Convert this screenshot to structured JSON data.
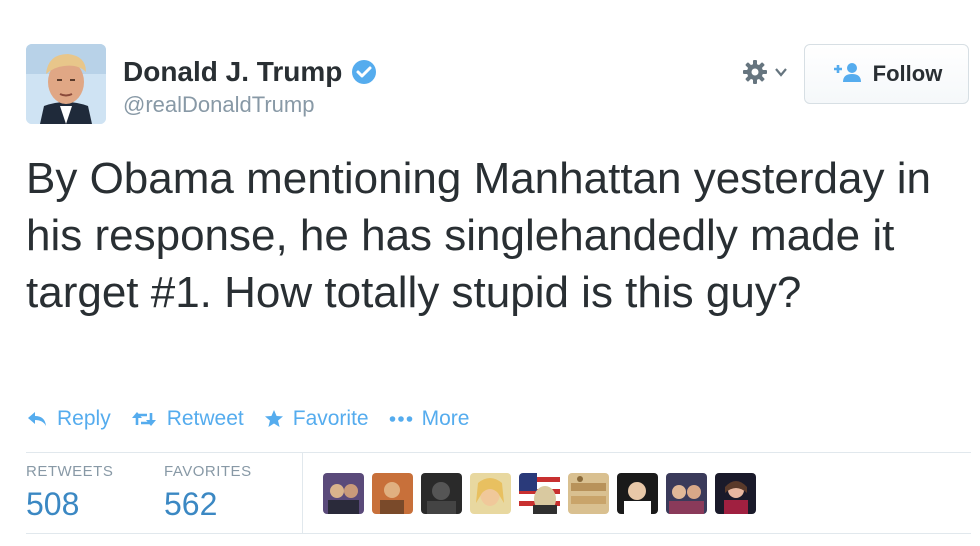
{
  "header": {
    "name": "Donald J. Trump",
    "handle": "@realDonaldTrump",
    "follow_label": "Follow"
  },
  "tweet": {
    "text": "By Obama mentioning Manhattan yesterday in his response, he has singlehandedly made it target #1. How totally stupid is this guy?"
  },
  "actions": {
    "reply": "Reply",
    "retweet": "Retweet",
    "favorite": "Favorite",
    "more": "More"
  },
  "stats": {
    "retweets_label": "RETWEETS",
    "retweets_value": "508",
    "favorites_label": "FAVORITES",
    "favorites_value": "562"
  },
  "icons": [
    "verified-badge-icon",
    "gear-icon",
    "chevron-down-icon",
    "follow-user-icon",
    "reply-icon",
    "retweet-icon",
    "star-icon",
    "more-dots-icon"
  ],
  "colors": {
    "accent": "#55acee",
    "stat_value": "#3b88c3",
    "text": "#292f33",
    "muted": "#8899a6"
  }
}
